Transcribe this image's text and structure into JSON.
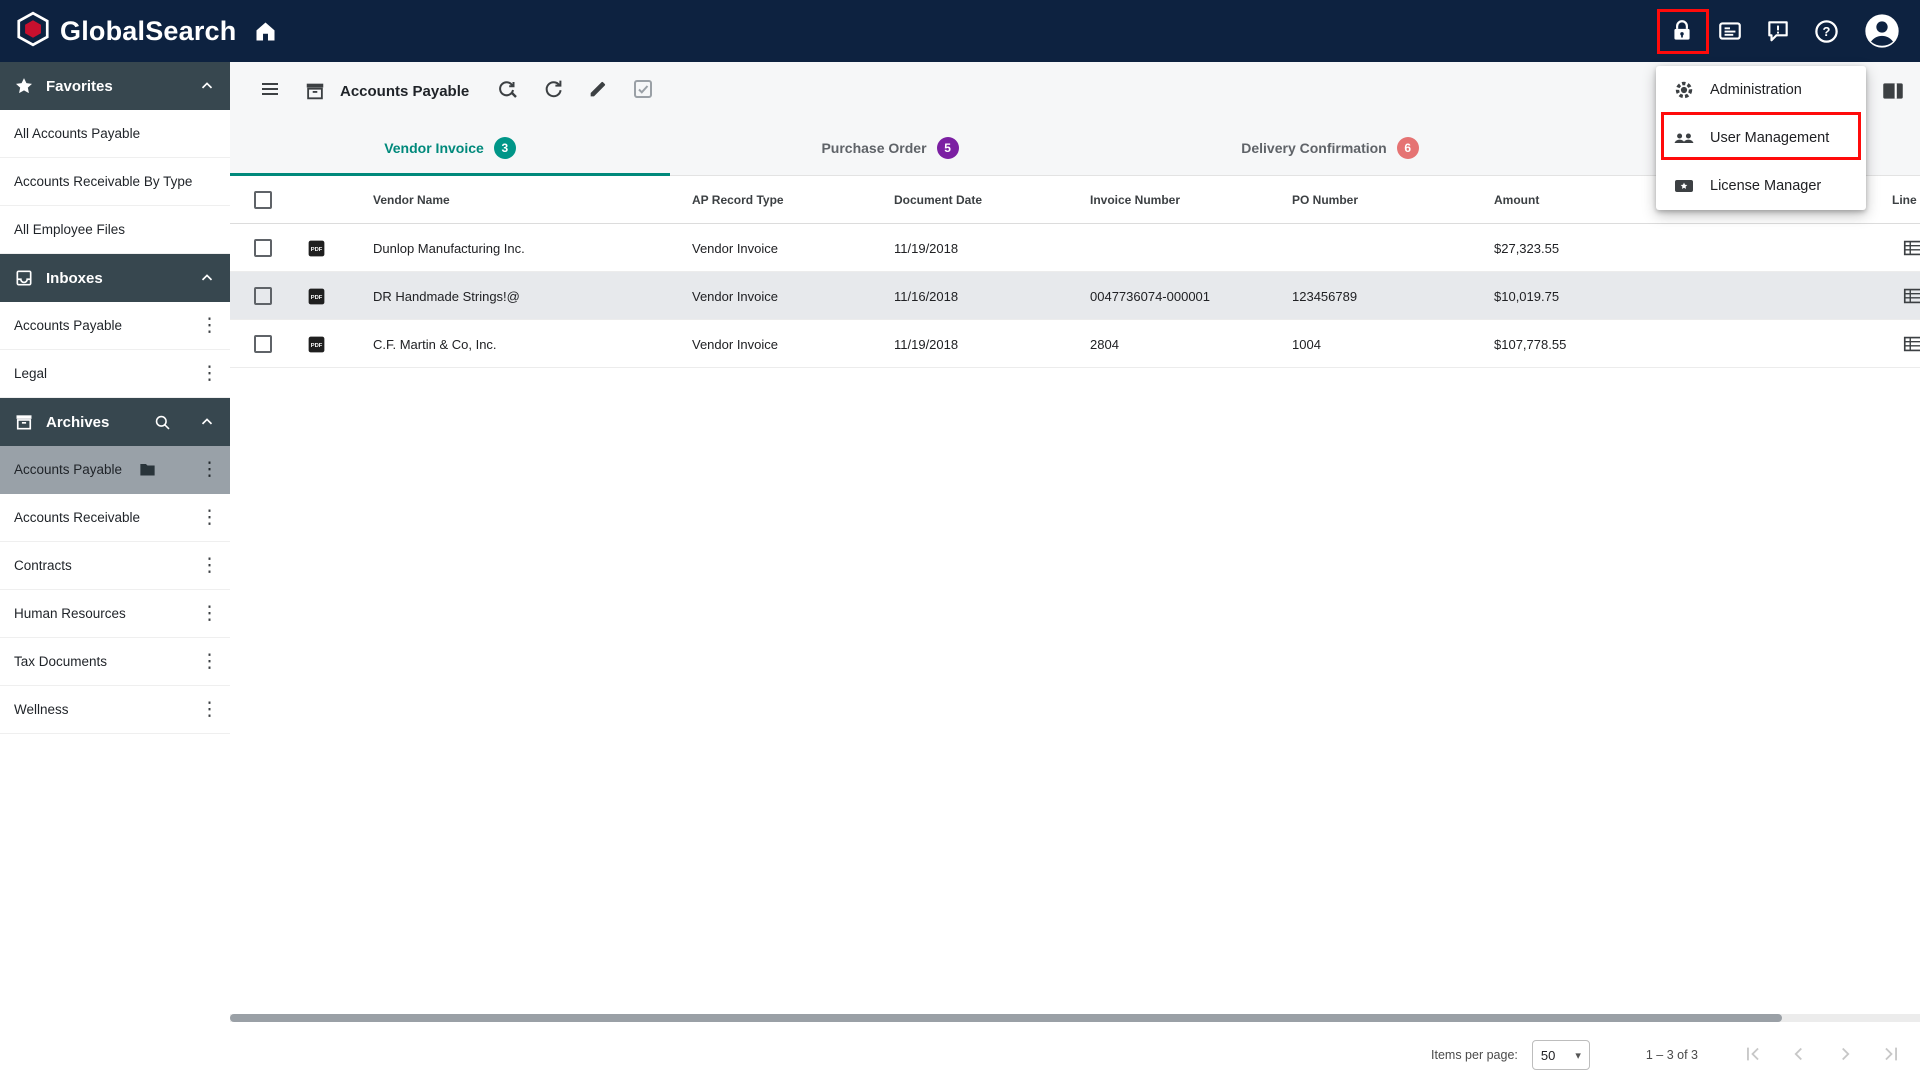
{
  "app": {
    "name": "GlobalSearch",
    "colors": {
      "topbar_bg": "#0d2240",
      "section_header_bg": "#37474f",
      "selected_item_bg": "#99a1a8",
      "active_tab": "#00897b",
      "row_highlight": "#e7e9ec",
      "annotation_red": "#ff0b0b"
    }
  },
  "account_menu": {
    "items": [
      {
        "label": "Administration"
      },
      {
        "label": "User Management"
      },
      {
        "label": "License Manager"
      }
    ]
  },
  "sidebar": {
    "favorites_title": "Favorites",
    "favorites": [
      "All Accounts Payable",
      "Accounts Receivable By Type",
      "All Employee Files"
    ],
    "inboxes_title": "Inboxes",
    "inboxes": [
      "Accounts Payable",
      "Legal"
    ],
    "archives_title": "Archives",
    "archives": [
      "Accounts Payable",
      "Accounts Receivable",
      "Contracts",
      "Human Resources",
      "Tax Documents",
      "Wellness"
    ],
    "selected_archive": "Accounts Payable"
  },
  "toolbar": {
    "title": "Accounts Payable"
  },
  "tabs": [
    {
      "label": "Vendor Invoice",
      "count": "3",
      "badge_color": "#009688",
      "active": true
    },
    {
      "label": "Purchase Order",
      "count": "5",
      "badge_color": "#7b1fa2",
      "active": false
    },
    {
      "label": "Delivery Confirmation",
      "count": "6",
      "badge_color": "#e57373",
      "active": false
    }
  ],
  "table": {
    "columns": {
      "vendor": "Vendor Name",
      "type": "AP Record Type",
      "date": "Document Date",
      "invoice": "Invoice Number",
      "po": "PO Number",
      "amount": "Amount",
      "line_items": "Line Items"
    },
    "rows": [
      {
        "vendor": "Dunlop Manufacturing Inc.",
        "type": "Vendor Invoice",
        "date": "11/19/2018",
        "invoice": "",
        "po": "",
        "amount": "$27,323.55"
      },
      {
        "vendor": "DR Handmade Strings!@",
        "type": "Vendor Invoice",
        "date": "11/16/2018",
        "invoice": "0047736074-000001",
        "po": "123456789",
        "amount": "$10,019.75"
      },
      {
        "vendor": "C.F. Martin & Co, Inc.",
        "type": "Vendor Invoice",
        "date": "11/19/2018",
        "invoice": "2804",
        "po": "1004",
        "amount": "$107,778.55"
      }
    ]
  },
  "pagination": {
    "items_per_page_label": "Items per page:",
    "items_per_page": "50",
    "range_label": "1 – 3 of 3"
  },
  "glyphs": {
    "kebab": "⋮",
    "caret_down": "▾"
  }
}
